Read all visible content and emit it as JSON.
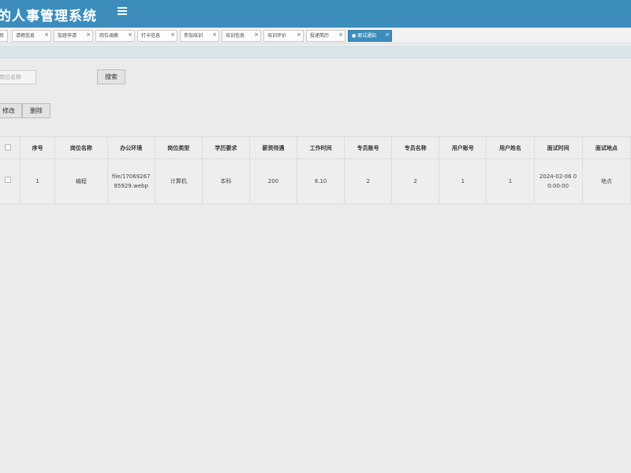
{
  "header": {
    "title": "的人事管理系统",
    "menu_icon": "hamburger-icon"
  },
  "tabs": [
    {
      "label": "页",
      "closable": false,
      "active": false
    },
    {
      "label": "请假信息",
      "closable": true,
      "active": false
    },
    {
      "label": "加班申请",
      "closable": true,
      "active": false
    },
    {
      "label": "岗位调换",
      "closable": true,
      "active": false
    },
    {
      "label": "打卡信息",
      "closable": true,
      "active": false
    },
    {
      "label": "参加培训",
      "closable": true,
      "active": false
    },
    {
      "label": "培训信息",
      "closable": true,
      "active": false
    },
    {
      "label": "培训评价",
      "closable": true,
      "active": false
    },
    {
      "label": "投递简历",
      "closable": true,
      "active": false
    },
    {
      "label": "● 面试通知",
      "closable": true,
      "active": true
    }
  ],
  "tab_close": "×",
  "search": {
    "placeholder": "岗位名称",
    "button_label": "搜索"
  },
  "actions": {
    "edit_label": "修改",
    "delete_label": "删除"
  },
  "table": {
    "headers": [
      "",
      "序号",
      "岗位名称",
      "办公环境",
      "岗位类型",
      "学历要求",
      "薪资待遇",
      "工作时间",
      "专员账号",
      "专员名称",
      "用户账号",
      "用户姓名",
      "面试时间",
      "面试地点"
    ],
    "rows": [
      [
        "",
        "1",
        "编程",
        "file/1706926785929.webp",
        "计算机",
        "本科",
        "200",
        "8.10",
        "2",
        "2",
        "1",
        "1",
        "2024-02-06 00:00:00",
        "地点"
      ]
    ]
  },
  "colors": {
    "header_bg": "#3c8dbc",
    "page_bg": "#ebebeb",
    "active_tab": "#3c8dbc"
  }
}
